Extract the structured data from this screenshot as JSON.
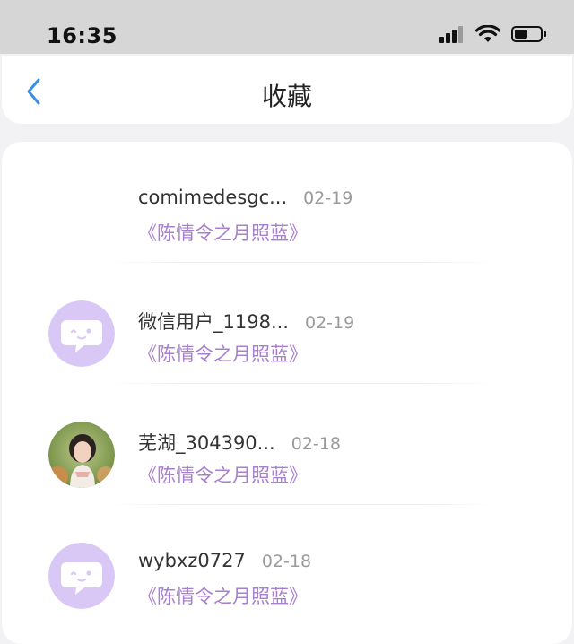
{
  "status_bar": {
    "time": "16:35"
  },
  "nav": {
    "title": "收藏"
  },
  "colors": {
    "accent": "#a87fcf",
    "avatar_bg": "#d9c8f5",
    "back": "#3a8ee6"
  },
  "items": [
    {
      "name": "comimedesgc...",
      "date": "02-19",
      "work": "《陈情令之月照蓝》",
      "avatar": "none"
    },
    {
      "name": "微信用户_1198...",
      "date": "02-19",
      "work": "《陈情令之月照蓝》",
      "avatar": "chat-bubble-icon"
    },
    {
      "name": "芜湖_304390...",
      "date": "02-18",
      "work": "《陈情令之月照蓝》",
      "avatar": "photo"
    },
    {
      "name": "wybxz0727",
      "date": "02-18",
      "work": "《陈情令之月照蓝》",
      "avatar": "chat-bubble-icon"
    }
  ]
}
